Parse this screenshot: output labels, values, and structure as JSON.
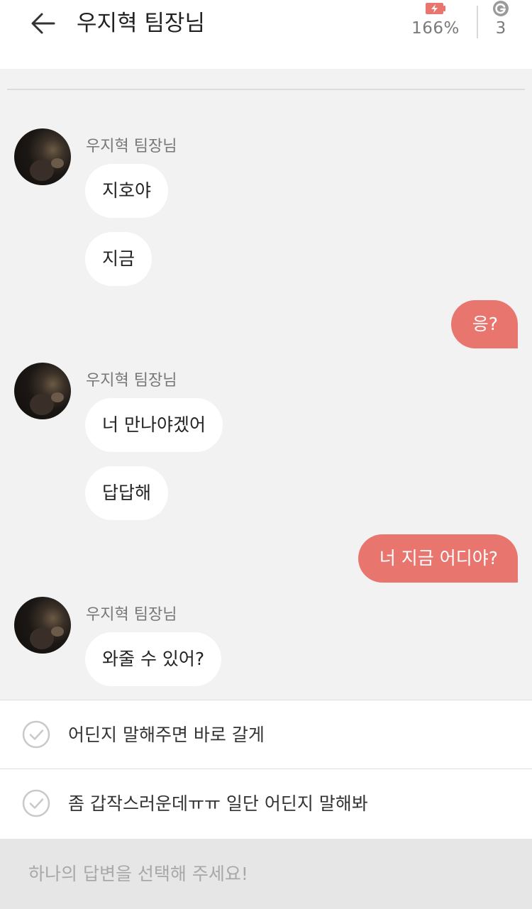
{
  "header": {
    "title": "우지혁 팀장님",
    "battery_percent": "166%",
    "coin_count": "3",
    "accent_color": "#e8766f"
  },
  "messages": [
    {
      "from": "other",
      "sender": "우지혁 팀장님",
      "bubbles": [
        "지호야",
        "지금"
      ]
    },
    {
      "from": "me",
      "text": "응?"
    },
    {
      "from": "other",
      "sender": "우지혁 팀장님",
      "bubbles": [
        "너 만나야겠어",
        "답답해"
      ]
    },
    {
      "from": "me",
      "text": "너 지금 어디야?"
    },
    {
      "from": "other",
      "sender": "우지혁 팀장님",
      "bubbles": [
        "와줄 수 있어?"
      ]
    }
  ],
  "reply_options": [
    {
      "label": "어딘지 말해주면 바로 갈게",
      "icon": "check-circle-icon"
    },
    {
      "label": "좀 갑작스러운데ㅠㅠ 일단 어딘지 말해봐",
      "icon": "check-circle-icon"
    }
  ],
  "bottom_hint": "하나의 답변을 선택해 주세요!"
}
